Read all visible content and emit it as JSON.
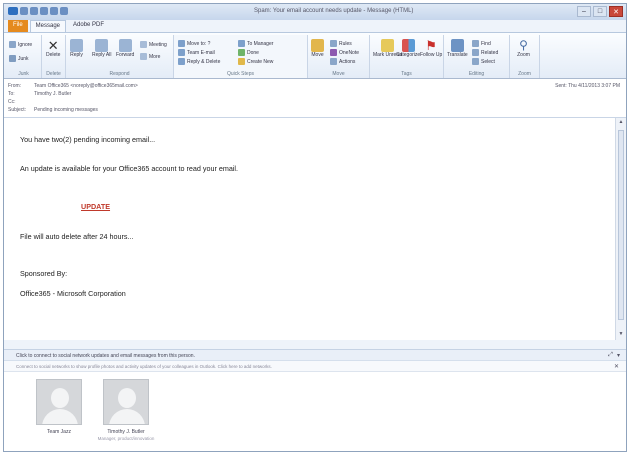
{
  "window": {
    "title": "Spam: Your email account needs update - Message (HTML)",
    "controls": [
      "–",
      "□",
      "✕"
    ]
  },
  "ribbon": {
    "tabs": [
      "File",
      "Message",
      "Adobe PDF"
    ],
    "groups": [
      {
        "label": "Junk",
        "buttons": [
          "Ignore",
          "Junk"
        ]
      },
      {
        "label": "Delete",
        "buttons": [
          "Delete"
        ]
      },
      {
        "label": "Respond",
        "buttons": [
          "Reply",
          "Reply All",
          "Forward",
          "Meeting",
          "More"
        ]
      },
      {
        "label": "Quick Steps",
        "buttons": [
          "Move to: ?",
          "To Manager",
          "Team E-mail",
          "Done",
          "Reply & Delete",
          "Create New"
        ]
      },
      {
        "label": "Move",
        "buttons": [
          "Move",
          "Rules",
          "OneNote",
          "Actions"
        ]
      },
      {
        "label": "Tags",
        "buttons": [
          "Mark Unread",
          "Categorize",
          "Follow Up"
        ]
      },
      {
        "label": "Editing",
        "buttons": [
          "Translate",
          "Find",
          "Related",
          "Select"
        ]
      },
      {
        "label": "Zoom",
        "buttons": [
          "Zoom"
        ]
      }
    ]
  },
  "header": {
    "from_label": "From:",
    "from_value": "Team Office365 <noreply@office365mail.com>",
    "to_label": "To:",
    "to_value": "Timothy J. Butler",
    "cc_label": "Cc:",
    "cc_value": "",
    "subject_label": "Subject:",
    "subject_value": "Pending incoming messages",
    "sent": "Sent: Thu 4/11/2013 3:07 PM"
  },
  "message": {
    "line1": "You have two(2) pending incoming email...",
    "line2": "An update is available for your Office365 account to read your email.",
    "update_link": "UPDATE",
    "line3": "File will auto delete after 24 hours...",
    "sponsored": "Sponsored By:",
    "sponsor_name": "Office365 - Microsoft Corporation"
  },
  "people_pane": {
    "bar_text": "Click to connect to social network updates and email messages from this person.",
    "info_text": "Connect to social networks to show profile photos and activity updates of your colleagues in Outlook. Click here to add networks.",
    "people": [
      {
        "name": "Team Jazz",
        "sub": ""
      },
      {
        "name": "Timothy J. Butler",
        "sub": "Manager, product/innovation"
      }
    ]
  }
}
